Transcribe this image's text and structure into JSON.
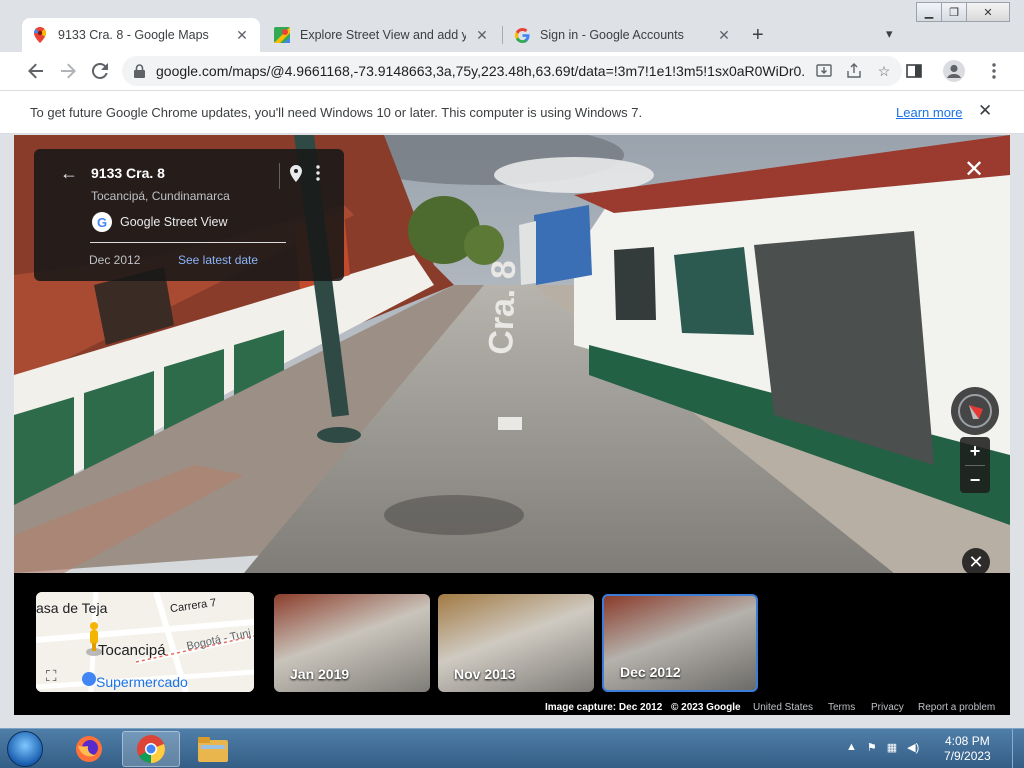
{
  "browser": {
    "tabs": [
      {
        "title": "9133 Cra. 8 - Google Maps",
        "active": true
      },
      {
        "title": "Explore Street View and add your",
        "active": false
      },
      {
        "title": "Sign in - Google Accounts",
        "active": false
      }
    ],
    "url": "google.com/maps/@4.9661168,-73.9148663,3a,75y,223.48h,63.69t/data=!3m7!1e1!3m5!1sx0aR0WiDr0...",
    "infobar": {
      "message": "To get future Google Chrome updates, you'll need Windows 10 or later. This computer is using Windows 7.",
      "link": "Learn more"
    }
  },
  "streetview": {
    "address": "9133 Cra. 8",
    "locality": "Tocancipá, Cundinamarca",
    "source": "Google Street View",
    "capture_date": "Dec 2012",
    "latest_link": "See latest date",
    "road_marking": "Cra. 8",
    "zoom_in": "+",
    "zoom_out": "−"
  },
  "timeline": {
    "minimap_labels": [
      "asa de Teja",
      "Carrera 7",
      "Tocancipá",
      "Bogotá - Tunj",
      "Supermercado"
    ],
    "thumbs": [
      {
        "label": "Jan 2019",
        "selected": false
      },
      {
        "label": "Nov 2013",
        "selected": false
      },
      {
        "label": "Dec 2012",
        "selected": true
      }
    ]
  },
  "footer": {
    "capture": "Image capture: Dec 2012",
    "copyright": "© 2023 Google",
    "region": "United States",
    "terms": "Terms",
    "privacy": "Privacy",
    "report": "Report a problem"
  },
  "taskbar": {
    "time": "4:08 PM",
    "date": "7/9/2023"
  },
  "colors": {
    "accent": "#1a73e8",
    "link_dark": "#8ab4f8",
    "selected_border": "#3b7dd8"
  }
}
